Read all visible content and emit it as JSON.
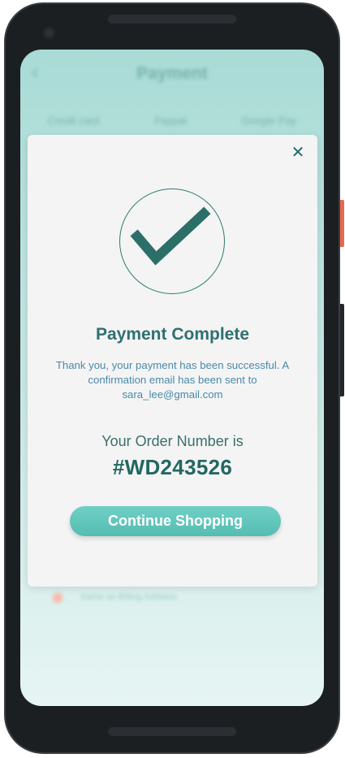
{
  "background": {
    "back_glyph": "‹",
    "title": "Payment",
    "tabs": [
      "Credit card",
      "Paypal",
      "Google Pay"
    ],
    "radio_label": "Same as Billing Address"
  },
  "modal": {
    "close_glyph": "✕",
    "title": "Payment Complete",
    "message": "Thank you, your payment has been successful. A confirmation email has been sent to sara_lee@gmail.com",
    "order_label": "Your Order Number is",
    "order_number": "#WD243526",
    "continue_label": "Continue Shopping"
  },
  "icons": {
    "success": "checkmark-icon",
    "close": "close-icon",
    "back": "back-arrow-icon"
  },
  "colors": {
    "accent": "#5fc6bb",
    "title": "#2f7070",
    "message": "#4a8aa8",
    "modal_bg": "#f4f4f4",
    "screen_bg": "#a9dbd6"
  }
}
